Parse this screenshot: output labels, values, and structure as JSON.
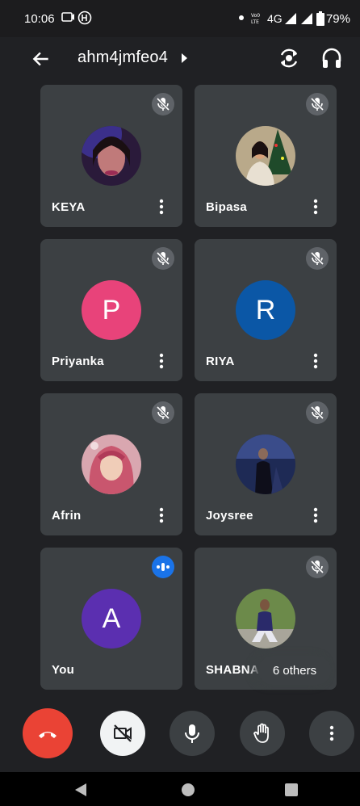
{
  "status_bar": {
    "time": "10:06",
    "network": "4G",
    "battery": "79%"
  },
  "header": {
    "meeting_code": "ahm4jmfeo4"
  },
  "participants": [
    {
      "name": "KEYA",
      "avatar_type": "photo",
      "mic": "muted"
    },
    {
      "name": "Bipasa",
      "avatar_type": "photo",
      "mic": "muted"
    },
    {
      "name": "Priyanka",
      "avatar_type": "letter",
      "letter": "P",
      "color": "#e8437a",
      "mic": "muted"
    },
    {
      "name": "RIYA",
      "avatar_type": "letter",
      "letter": "R",
      "color": "#0b57a6",
      "mic": "muted"
    },
    {
      "name": "Afrin",
      "avatar_type": "photo",
      "mic": "muted"
    },
    {
      "name": "Joysree",
      "avatar_type": "photo",
      "mic": "muted"
    },
    {
      "name": "You",
      "avatar_type": "letter",
      "letter": "A",
      "color": "#5b2fb0",
      "mic": "speaking"
    },
    {
      "name": "SHABNAM",
      "avatar_type": "photo",
      "mic": "muted"
    }
  ],
  "others_badge": "6 others",
  "colors": {
    "background": "#202124",
    "tile": "#3c4043",
    "end_call": "#ea4335",
    "speaking_indicator": "#1a73e8"
  },
  "controls": {
    "buttons": [
      "end-call",
      "camera-off",
      "microphone",
      "raise-hand",
      "more-options"
    ]
  }
}
